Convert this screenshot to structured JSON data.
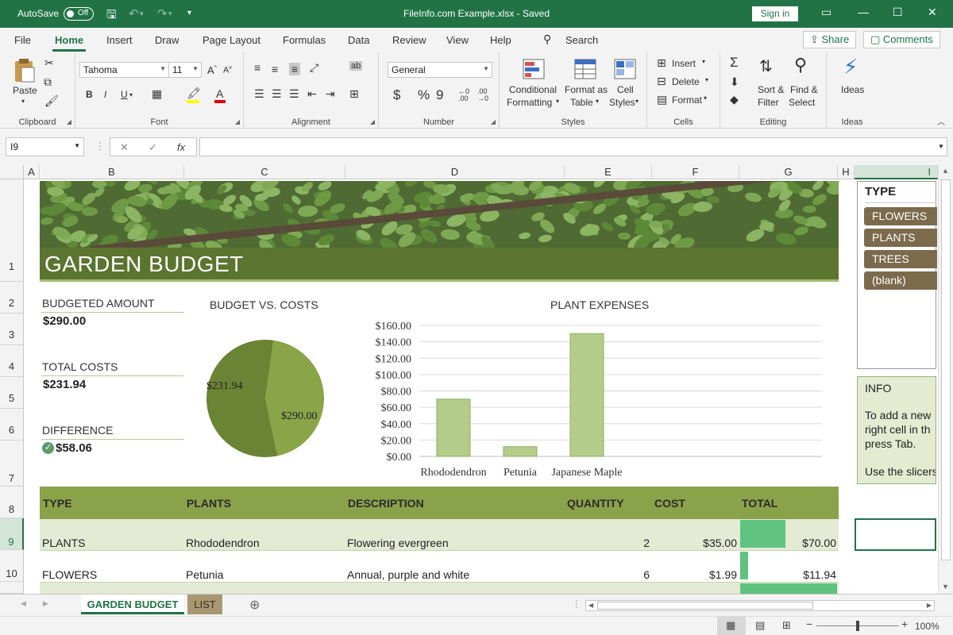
{
  "titlebar": {
    "autosave_label": "AutoSave",
    "autosave_state": "Off",
    "document_title": "FileInfo.com Example.xlsx  -  Saved",
    "signin_label": "Sign in"
  },
  "ribbon_tabs": [
    "File",
    "Home",
    "Insert",
    "Draw",
    "Page Layout",
    "Formulas",
    "Data",
    "Review",
    "View",
    "Help"
  ],
  "search_label": "Search",
  "share_label": "Share",
  "comments_label": "Comments",
  "ribbon": {
    "clipboard": {
      "paste": "Paste",
      "label": "Clipboard"
    },
    "font": {
      "name": "Tahoma",
      "size": "11",
      "label": "Font",
      "bold": "B",
      "italic": "I",
      "underline": "U"
    },
    "alignment": {
      "label": "Alignment"
    },
    "number": {
      "format": "General",
      "label": "Number",
      "currency": "$",
      "percent": "%",
      "comma": "9"
    },
    "styles": {
      "cond_1": "Conditional",
      "cond_2": "Formatting",
      "fmt_1": "Format as",
      "fmt_2": "Table",
      "cell_1": "Cell",
      "cell_2": "Styles",
      "label": "Styles"
    },
    "cells": {
      "insert": "Insert",
      "delete": "Delete",
      "format": "Format",
      "label": "Cells"
    },
    "editing": {
      "sort_1": "Sort &",
      "sort_2": "Filter",
      "find_1": "Find &",
      "find_2": "Select",
      "label": "Editing"
    },
    "ideas": {
      "button": "Ideas",
      "label": "Ideas"
    }
  },
  "formula_bar": {
    "name_box": "I9",
    "cancel": "✕",
    "enter": "✓",
    "fx": "fx",
    "formula": ""
  },
  "columns": [
    "A",
    "B",
    "C",
    "D",
    "E",
    "F",
    "G",
    "H",
    "I"
  ],
  "rows": [
    "1",
    "2",
    "3",
    "4",
    "5",
    "6",
    "7",
    "8",
    "9",
    "10"
  ],
  "sheet": {
    "title": "GARDEN BUDGET",
    "budgeted_label": "BUDGETED AMOUNT",
    "budgeted_value": "$290.00",
    "total_costs_label": "TOTAL COSTS",
    "total_costs_value": "$231.94",
    "difference_label": "DIFFERENCE",
    "difference_value": "$58.06",
    "table_headers": [
      "TYPE",
      "PLANTS",
      "DESCRIPTION",
      "QUANTITY",
      "COST",
      "TOTAL"
    ],
    "table_rows": [
      {
        "type": "PLANTS",
        "plant": "Rhododendron",
        "description": "Flowering evergreen",
        "quantity": "2",
        "cost": "$35.00",
        "total": "$70.00",
        "bar_fraction": 0.47
      },
      {
        "type": "FLOWERS",
        "plant": "Petunia",
        "description": "Annual, purple and white",
        "quantity": "6",
        "cost": "$1.99",
        "total": "$11.94",
        "bar_fraction": 0.08
      }
    ]
  },
  "chart_data": [
    {
      "type": "pie",
      "title": "BUDGET VS. COSTS",
      "labels": [
        "$231.94",
        "$290.00"
      ],
      "values": [
        231.94,
        290.0
      ],
      "colors": [
        "#8aa448",
        "#6b8334"
      ]
    },
    {
      "type": "bar",
      "title": "PLANT EXPENSES",
      "categories": [
        "Rhododendron",
        "Petunia",
        "Japanese Maple"
      ],
      "values": [
        70.0,
        11.94,
        150.0
      ],
      "ylim": [
        0,
        160
      ],
      "yticks": [
        "$0.00",
        "$20.00",
        "$40.00",
        "$60.00",
        "$80.00",
        "$100.00",
        "$120.00",
        "$140.00",
        "$160.00"
      ],
      "grid": true,
      "bar_color": "#b3cc8a"
    }
  ],
  "slicer": {
    "title": "TYPE",
    "items": [
      "FLOWERS",
      "PLANTS",
      "TREES",
      "(blank)"
    ]
  },
  "info": {
    "title": "INFO",
    "line1": "To add a new",
    "line2": "right cell in th",
    "line3": "press Tab.",
    "line4": "Use the slicers"
  },
  "sheet_tabs": [
    "GARDEN BUDGET",
    "LIST"
  ],
  "status": {
    "zoom": "100%"
  },
  "colors": {
    "brand": "#217346",
    "header_green": "#8aa24a",
    "title_green": "#5b742f",
    "slicer_brown": "#7b6a4c",
    "databar": "#5fc27f"
  }
}
